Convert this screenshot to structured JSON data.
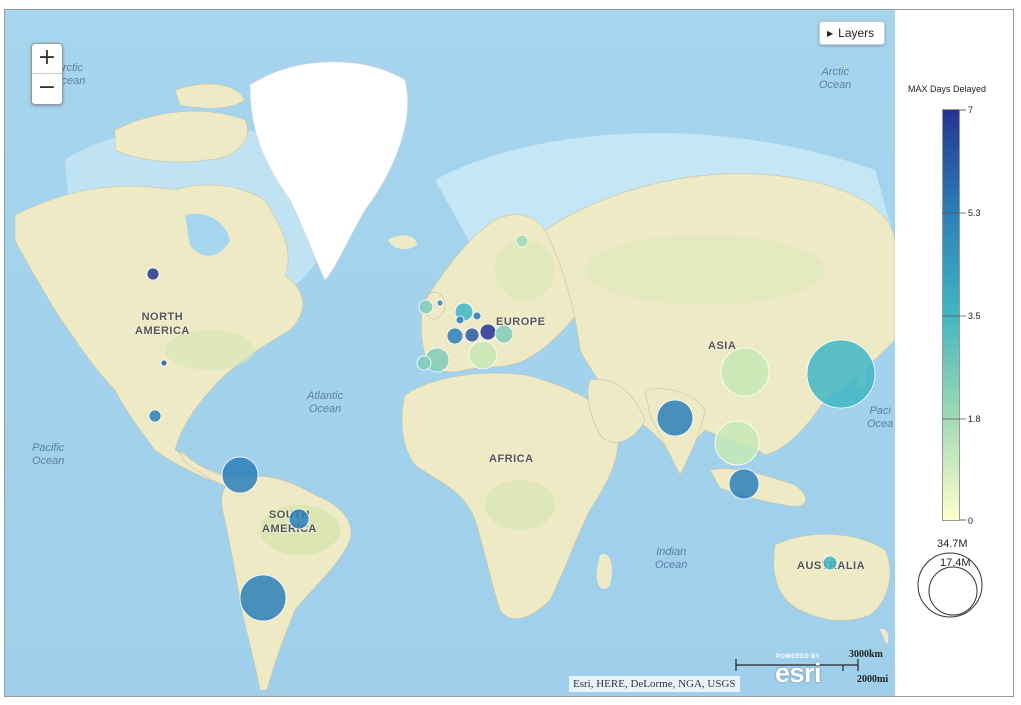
{
  "map": {
    "zoom_in_label": "+",
    "zoom_out_label": "−",
    "layers_label": "Layers",
    "attribution": "Esri, HERE, DeLorme, NGA, USGS",
    "logo_powered": "POWERED BY",
    "logo_word": "esri",
    "scale_km": "3000km",
    "scale_mi": "2000mi",
    "ocean_labels": {
      "arctic_left": "Arctic\nOcean",
      "arctic_right": "Arctic\nOcean",
      "atlantic": "Atlantic\nOcean",
      "pacific_left": "Pacific\nOcean",
      "pacific_right": "Paci\nOcea",
      "indian": "Indian\nOcean"
    },
    "continent_labels": {
      "north_america": "NORTH\nAMERICA",
      "south_america": "SOUTH\nAMERICA",
      "europe": "EUROPE",
      "africa": "AFRICA",
      "asia": "ASIA",
      "australia": "AUSTRALIA"
    }
  },
  "legend": {
    "title": "MAX Days Delayed",
    "ticks": [
      "7",
      "5.3",
      "3.5",
      "1.8",
      "0"
    ],
    "size_large": "34.7M",
    "size_small": "17.4M",
    "color_low": "#ffffcc",
    "color_high": "#253494"
  }
}
